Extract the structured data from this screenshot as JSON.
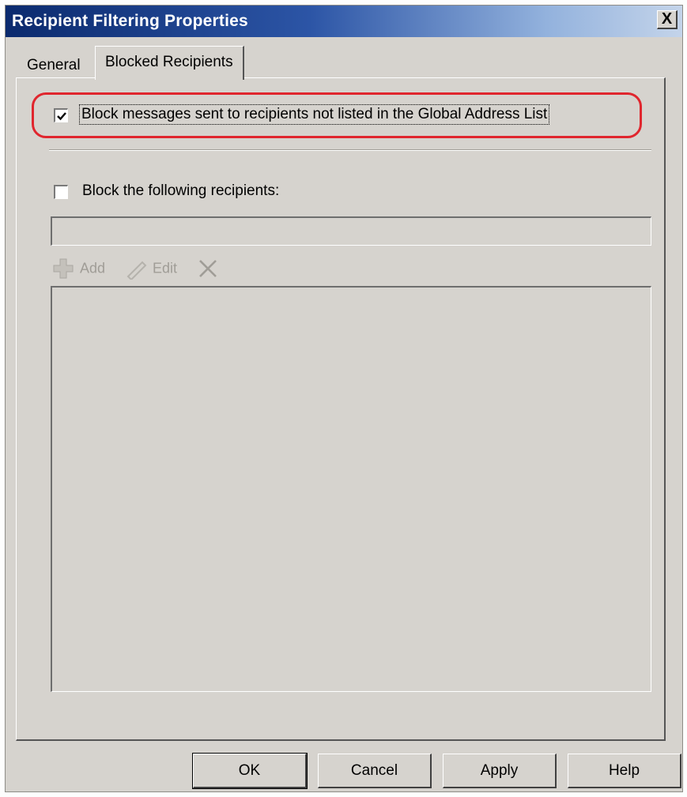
{
  "window": {
    "title": "Recipient Filtering Properties",
    "close_label": "X"
  },
  "tabs": [
    {
      "label": "General",
      "active": false
    },
    {
      "label": "Blocked Recipients",
      "active": true
    }
  ],
  "options": {
    "block_gal": {
      "label": "Block messages sent to recipients not listed in the Global Address List",
      "checked": true
    },
    "block_following": {
      "label": "Block the following recipients:",
      "checked": false
    }
  },
  "recipient_input": {
    "value": ""
  },
  "toolbar": {
    "add_label": "Add",
    "edit_label": "Edit",
    "icons": {
      "add": "add-icon",
      "edit": "pencil-icon",
      "remove": "delete-x-icon"
    }
  },
  "recipient_list": [],
  "buttons": {
    "ok": "OK",
    "cancel": "Cancel",
    "apply": "Apply",
    "help": "Help"
  },
  "colors": {
    "highlight": "#e0262e",
    "titlebar_start": "#0b2a6e",
    "dialog_bg": "#d6d3ce"
  }
}
